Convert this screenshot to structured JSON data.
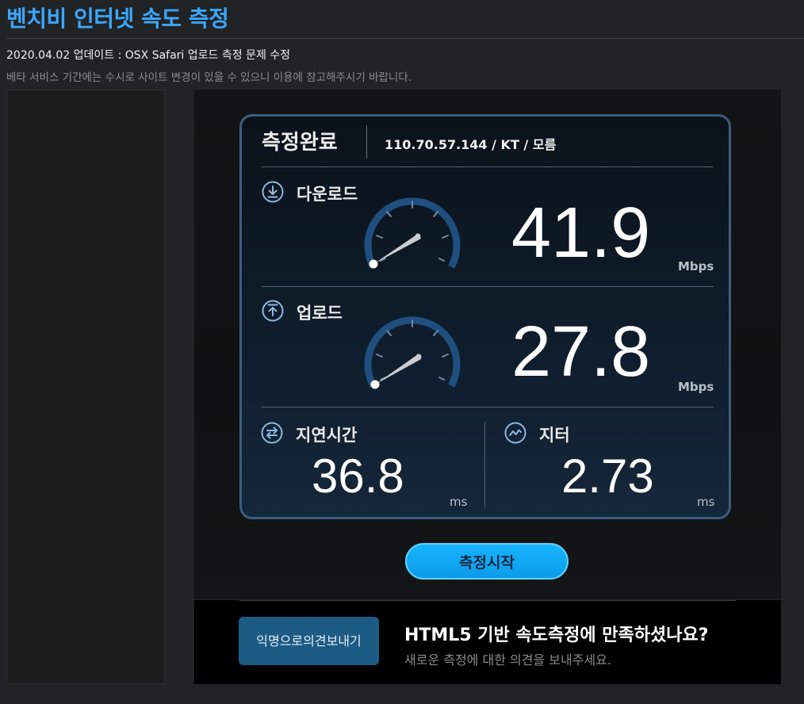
{
  "page": {
    "title": "벤치비 인터넷 속도 측정",
    "update_notice": "2020.04.02 업데이트 : OSX Safari 업로드 측정 문제 수정",
    "beta_notice": "베타 서비스 기간에는 수시로 사이트 변경이 있을 수 있으니 이용에 참고해주시기 바랍니다."
  },
  "result": {
    "status": "측정완료",
    "connection_info": "110.70.57.144 / KT / 모름",
    "download": {
      "label": "다운로드",
      "value": "41.9",
      "unit": "Mbps"
    },
    "upload": {
      "label": "업로드",
      "value": "27.8",
      "unit": "Mbps"
    },
    "latency": {
      "label": "지연시간",
      "value": "36.8",
      "unit": "ms"
    },
    "jitter": {
      "label": "지터",
      "value": "2.73",
      "unit": "ms"
    }
  },
  "controls": {
    "start_label": "측정시작"
  },
  "feedback": {
    "button_label": "익명으로의견보내기",
    "title": "HTML5 기반 속도측정에 만족하셨나요?",
    "subtitle": "새로운 측정에 대한 의견을 보내주세요."
  },
  "colors": {
    "accent": "#3aa7ff",
    "button": "#0a9be8",
    "card_border": "#3d5c80",
    "gauge_arc": "#1e4f7e"
  },
  "icons": {
    "download": "download-circle-icon",
    "upload": "upload-circle-icon",
    "latency": "swap-arrows-icon",
    "jitter": "wave-icon"
  }
}
